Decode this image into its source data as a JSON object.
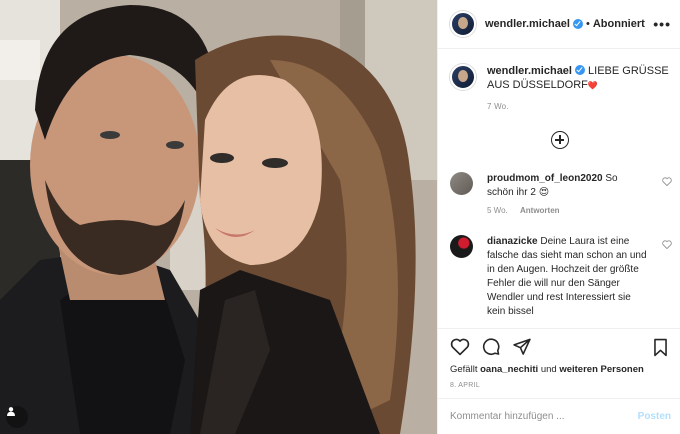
{
  "post": {
    "username": "wendler.michael",
    "follow_status": "Abonniert",
    "separator": "•",
    "more_icon": "more-horizontal-icon",
    "caption": "LIEBE GRÜSSE AUS DÜSSELDORF",
    "caption_emoji": "❤️",
    "time_ago": "7 Wo."
  },
  "comments": [
    {
      "username": "proudmom_of_leon2020",
      "text": "So schön ihr 2 😍",
      "time_ago": "5 Wo.",
      "reply_label": "Antworten"
    },
    {
      "username": "dianazicke",
      "text": "Deine Laura ist eine falsche das sieht man schon an und in den Augen. Hochzeit der größte Fehler die will nur den Sänger Wendler und rest Interessiert sie kein bissel"
    }
  ],
  "actions": {
    "icons": [
      "heart-icon",
      "comment-icon",
      "share-icon",
      "bookmark-icon"
    ],
    "likes_prefix": "Gefällt",
    "likes_user": "oana_nechiti",
    "likes_joiner": "und",
    "likes_suffix": "weiteren Personen",
    "date": "8. APRIL"
  },
  "comment_box": {
    "placeholder": "Kommentar hinzufügen ...",
    "post_label": "Posten"
  },
  "colors": {
    "verified": "#3897f0",
    "post_button_disabled": "#b2dffc",
    "meta_gray": "#8e8e8e"
  }
}
